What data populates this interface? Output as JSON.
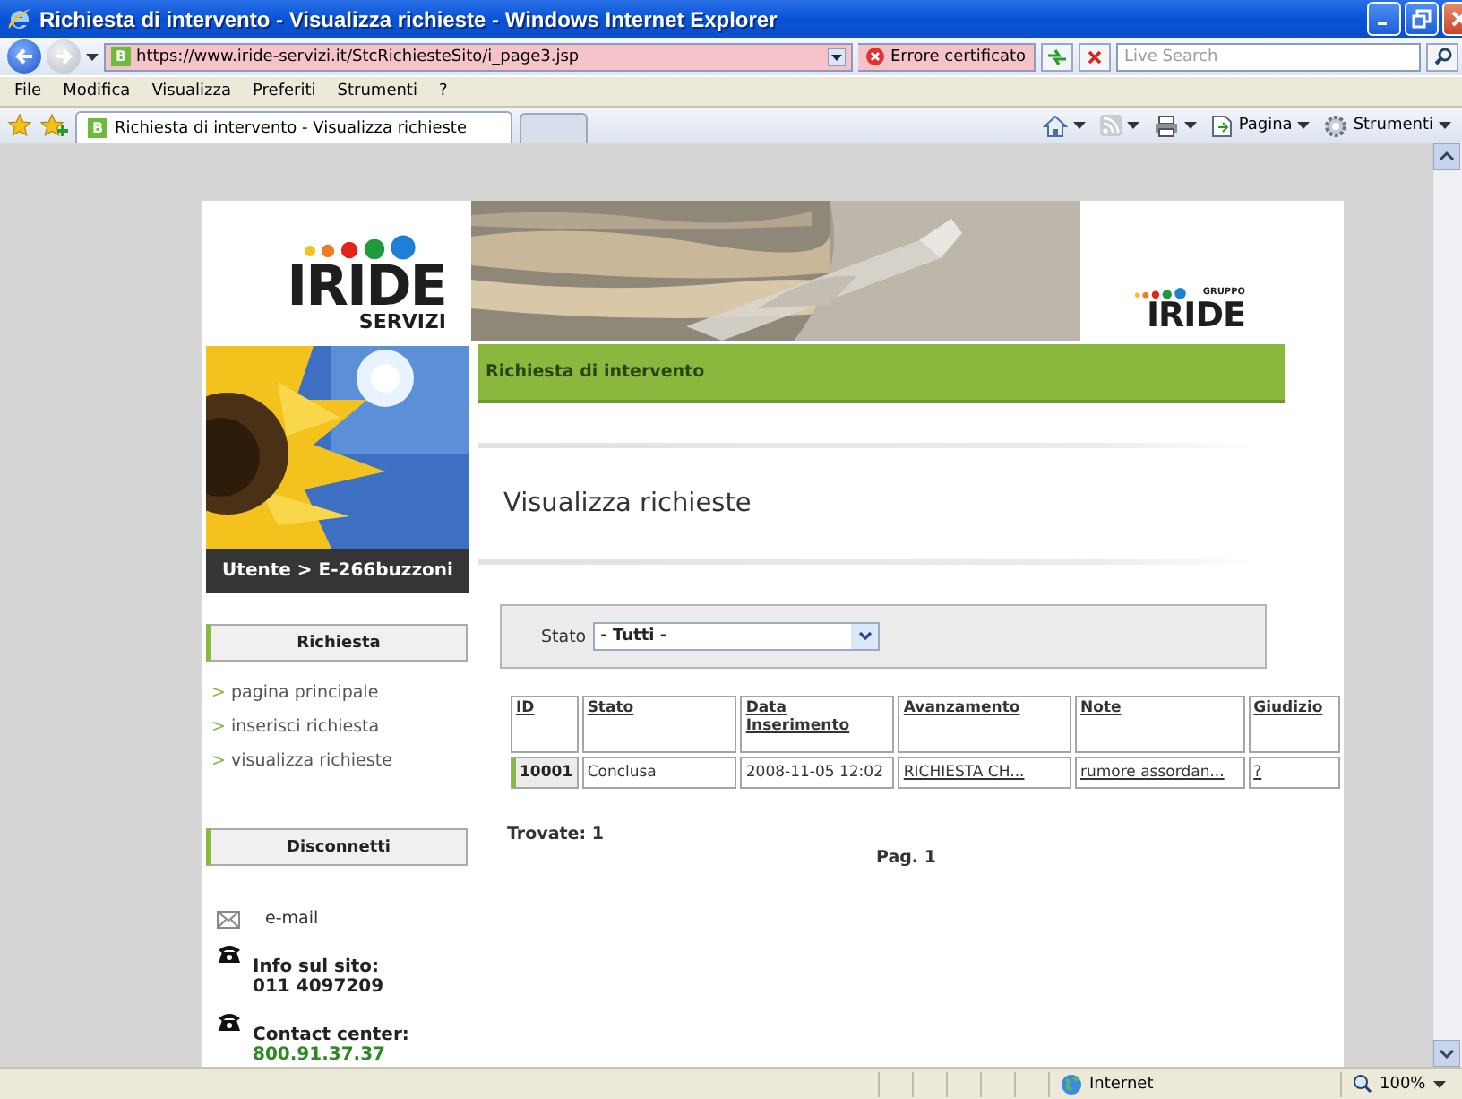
{
  "window": {
    "title": "Richiesta di intervento - Visualizza richieste - Windows Internet Explorer"
  },
  "address_bar": {
    "favicon": "B",
    "url": "https://www.iride-servizi.it/StcRichiesteSito/i_page3.jsp",
    "certificate_error": "Errore certificato",
    "search_placeholder": "Live Search"
  },
  "menu": [
    "File",
    "Modifica",
    "Visualizza",
    "Preferiti",
    "Strumenti",
    "?"
  ],
  "tabs": [
    {
      "favicon": "B",
      "label": "Richiesta di intervento - Visualizza richieste",
      "selected": true
    }
  ],
  "command_bar": [
    {
      "kind": "home"
    },
    {
      "kind": "feed"
    },
    {
      "kind": "print"
    },
    {
      "kind": "page",
      "label": "Pagina"
    },
    {
      "kind": "tools",
      "label": "Strumenti"
    }
  ],
  "page": {
    "logo": {
      "name": "IRIDE",
      "subtitle": "SERVIZI"
    },
    "group_logo": {
      "label": "GRUPPO",
      "name": "IRIDE"
    },
    "user_bar": "Utente > E-266buzzoni",
    "section_bar": "Richiesta di intervento",
    "heading": "Visualizza richieste",
    "sidebar": {
      "bullet": ">",
      "sections": [
        {
          "title": "Richiesta",
          "links": [
            "pagina principale",
            "inserisci richiesta",
            "visualizza richieste"
          ]
        },
        {
          "title": "Disconnetti"
        }
      ]
    },
    "contacts": [
      {
        "kind": "email",
        "label": "e-mail"
      },
      {
        "kind": "phone",
        "label": "Info sul sito:",
        "value": "011 4097209",
        "highlight": false
      },
      {
        "kind": "phone",
        "label": "Contact center:",
        "value": "800.91.37.37",
        "highlight": true
      }
    ],
    "filter": {
      "label": "Stato",
      "value": "- Tutti -"
    },
    "table": {
      "columns": [
        {
          "label": "ID",
          "kind": "button"
        },
        {
          "label": "Stato",
          "kind": "text"
        },
        {
          "label": "Data Inserimento",
          "kind": "text"
        },
        {
          "label": "Avanzamento",
          "kind": "link"
        },
        {
          "label": "Note",
          "kind": "link"
        },
        {
          "label": "Giudizio",
          "kind": "link"
        }
      ],
      "rows": [
        [
          "10001",
          "Conclusa",
          "2008-11-05 12:02",
          "RICHIESTA CH...",
          "rumore assordan...",
          "?"
        ]
      ]
    },
    "found": "Trovate: 1",
    "pagination": "Pag. 1"
  },
  "status_bar": {
    "zone": "Internet",
    "zoom": "100%"
  }
}
